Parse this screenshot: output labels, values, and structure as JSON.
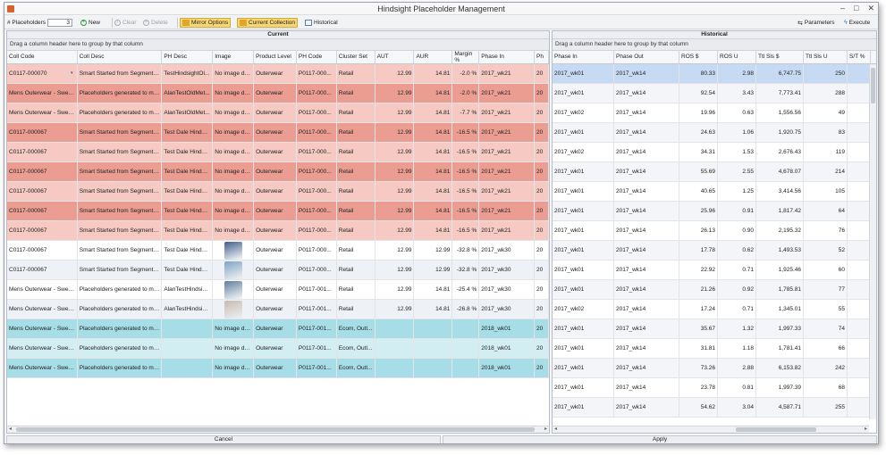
{
  "window": {
    "title": "Hindsight Placeholder Management"
  },
  "toolbar": {
    "placeholders_label": "# Placeholders",
    "placeholders_value": "3",
    "new_label": "New",
    "clear_label": "Clear",
    "delete_label": "Delete",
    "mirror_options_label": "Mirror Options",
    "current_collection_label": "Current Collection",
    "historical_label": "Historical",
    "parameters_label": "Parameters",
    "execute_label": "Execute"
  },
  "current": {
    "title": "Current",
    "group_hint": "Drag a column header here to group by that column",
    "columns": [
      "Coll Code",
      "Coll Desc",
      "PH Desc",
      "Image",
      "Product Level",
      "PH Code",
      "Cluster Set",
      "AUT",
      "AUR",
      "Margin %",
      "Phase In",
      "Ph"
    ],
    "rows": [
      {
        "c": [
          "C0117-000070",
          "Smart Started from Segment ...",
          "TestHindsightOl...",
          "No image data",
          "Outerwear",
          "P0117-000...",
          "Retail",
          "12.99",
          "14.81",
          "-2.0 %",
          "2017_wk21",
          "20"
        ],
        "shade": "light",
        "img": ""
      },
      {
        "c": [
          "Mens Outerwear - Swea...",
          "Placeholders generated to ma...",
          "AlanTestOldMet...",
          "No image data",
          "Outerwear",
          "P0117-000...",
          "Retail",
          "12.99",
          "14.81",
          "-2.0 %",
          "2017_wk21",
          "20"
        ],
        "shade": "dark",
        "img": ""
      },
      {
        "c": [
          "Mens Outerwear - Swea...",
          "Placeholders generated to ma...",
          "AlanTestOldMet...",
          "No image data",
          "Outerwear",
          "P0117-000...",
          "Retail",
          "12.99",
          "14.81",
          "-7.7 %",
          "2017_wk21",
          "20"
        ],
        "shade": "light",
        "img": ""
      },
      {
        "c": [
          "C0117-000067",
          "Smart Started from Segment ...",
          "Test Dale Hindsight",
          "No image data",
          "Outerwear",
          "P0117-000...",
          "Retail",
          "12.99",
          "14.81",
          "-16.5 %",
          "2017_wk21",
          "20"
        ],
        "shade": "dark",
        "img": ""
      },
      {
        "c": [
          "C0117-000067",
          "Smart Started from Segment ...",
          "Test Dale Hindsight",
          "No image data",
          "Outerwear",
          "P0117-000...",
          "Retail",
          "12.99",
          "14.81",
          "-16.5 %",
          "2017_wk21",
          "20"
        ],
        "shade": "light",
        "img": ""
      },
      {
        "c": [
          "C0117-000067",
          "Smart Started from Segment ...",
          "Test Dale Hindsight",
          "No image data",
          "Outerwear",
          "P0117-000...",
          "Retail",
          "12.99",
          "14.81",
          "-16.5 %",
          "2017_wk21",
          "20"
        ],
        "shade": "dark",
        "img": ""
      },
      {
        "c": [
          "C0117-000067",
          "Smart Started from Segment ...",
          "Test Dale Hindsight",
          "No image data",
          "Outerwear",
          "P0117-000...",
          "Retail",
          "12.99",
          "14.81",
          "-16.5 %",
          "2017_wk21",
          "20"
        ],
        "shade": "light",
        "img": ""
      },
      {
        "c": [
          "C0117-000067",
          "Smart Started from Segment ...",
          "Test Dale Hindsight",
          "No image data",
          "Outerwear",
          "P0117-000...",
          "Retail",
          "12.99",
          "14.81",
          "-16.5 %",
          "2017_wk21",
          "20"
        ],
        "shade": "dark",
        "img": ""
      },
      {
        "c": [
          "C0117-000067",
          "Smart Started from Segment ...",
          "Test Dale Hindsight",
          "No image data",
          "Outerwear",
          "P0117-000...",
          "Retail",
          "12.99",
          "14.81",
          "-16.5 %",
          "2017_wk21",
          "20"
        ],
        "shade": "light",
        "img": ""
      },
      {
        "c": [
          "C0117-000067",
          "Smart Started from Segment ...",
          "Test Dale Hindsight",
          "",
          "Outerwear",
          "P0117-000...",
          "Retail",
          "12.99",
          "12.99",
          "-32.8 %",
          "2017_wk30",
          "20"
        ],
        "shade": "white",
        "img": "#3e5d8a"
      },
      {
        "c": [
          "C0117-000067",
          "Smart Started from Segment ...",
          "Test Dale Hindsight",
          "",
          "Outerwear",
          "P0117-000...",
          "Retail",
          "12.99",
          "12.99",
          "-32.8 %",
          "2017_wk30",
          "20"
        ],
        "shade": "white",
        "img": "#7fa3c4"
      },
      {
        "c": [
          "Mens Outerwear - Swea...",
          "Placeholders generated to ma...",
          "AlanTestHindsig...",
          "",
          "Outerwear",
          "P0117-001...",
          "Retail",
          "12.99",
          "14.81",
          "-25.4 %",
          "2017_wk30",
          "20"
        ],
        "shade": "white",
        "img": "#5d7f9e"
      },
      {
        "c": [
          "Mens Outerwear - Swea...",
          "Placeholders generated to ma...",
          "AlanTestHindsig...",
          "",
          "Outerwear",
          "P0117-001...",
          "Retail",
          "12.99",
          "14.81",
          "-26.8 %",
          "2017_wk30",
          "20"
        ],
        "shade": "white",
        "img": "#c9b9ae"
      },
      {
        "c": [
          "Mens Outerwear - Swea...",
          "Placeholders generated to ma...",
          "",
          "No image data",
          "Outerwear",
          "P0117-001...",
          "Ecom, Outl...",
          "",
          "",
          "",
          "2018_wk01",
          "20"
        ],
        "shade": "cyan",
        "img": ""
      },
      {
        "c": [
          "Mens Outerwear - Swea...",
          "Placeholders generated to ma...",
          "",
          "No image data",
          "Outerwear",
          "P0117-001...",
          "Ecom, Outl...",
          "",
          "",
          "",
          "2018_wk01",
          "20"
        ],
        "shade": "cyanl",
        "img": ""
      },
      {
        "c": [
          "Mens Outerwear - Swea...",
          "Placeholders generated to ma...",
          "",
          "No image data",
          "Outerwear",
          "P0117-001...",
          "Ecom, Outl...",
          "",
          "",
          "",
          "2018_wk01",
          "20"
        ],
        "shade": "cyan",
        "img": ""
      }
    ]
  },
  "historical": {
    "title": "Historical",
    "group_hint": "Drag a column header here to group by that column",
    "columns": [
      "Phase In",
      "Phase Out",
      "ROS $",
      "ROS U",
      "Ttl Sls $",
      "Ttl Sls U",
      "S/T %"
    ],
    "rows": [
      [
        "2017_wk01",
        "2017_wk14",
        "80.33",
        "2.98",
        "6,747.75",
        "250",
        ""
      ],
      [
        "2017_wk01",
        "2017_wk14",
        "92.54",
        "3.43",
        "7,773.41",
        "288",
        ""
      ],
      [
        "2017_wk02",
        "2017_wk14",
        "19.96",
        "0.63",
        "1,556.56",
        "49",
        ""
      ],
      [
        "2017_wk01",
        "2017_wk14",
        "24.63",
        "1.06",
        "1,920.75",
        "83",
        ""
      ],
      [
        "2017_wk02",
        "2017_wk14",
        "34.31",
        "1.53",
        "2,676.43",
        "119",
        ""
      ],
      [
        "2017_wk01",
        "2017_wk14",
        "55.69",
        "2.55",
        "4,678.07",
        "214",
        ""
      ],
      [
        "2017_wk01",
        "2017_wk14",
        "40.65",
        "1.25",
        "3,414.56",
        "105",
        ""
      ],
      [
        "2017_wk01",
        "2017_wk14",
        "25.96",
        "0.91",
        "1,817.42",
        "64",
        ""
      ],
      [
        "2017_wk01",
        "2017_wk14",
        "26.13",
        "0.90",
        "2,195.32",
        "76",
        ""
      ],
      [
        "2017_wk01",
        "2017_wk14",
        "17.78",
        "0.62",
        "1,493.53",
        "52",
        ""
      ],
      [
        "2017_wk01",
        "2017_wk14",
        "22.92",
        "0.71",
        "1,925.46",
        "60",
        ""
      ],
      [
        "2017_wk01",
        "2017_wk14",
        "21.26",
        "0.92",
        "1,785.81",
        "77",
        ""
      ],
      [
        "2017_wk02",
        "2017_wk14",
        "17.24",
        "0.71",
        "1,345.01",
        "55",
        ""
      ],
      [
        "2017_wk01",
        "2017_wk14",
        "35.67",
        "1.32",
        "1,997.33",
        "74",
        ""
      ],
      [
        "2017_wk01",
        "2017_wk14",
        "31.81",
        "1.18",
        "1,781.41",
        "66",
        ""
      ],
      [
        "2017_wk01",
        "2017_wk14",
        "73.26",
        "2.88",
        "6,153.82",
        "242",
        ""
      ],
      [
        "2017_wk01",
        "2017_wk14",
        "23.78",
        "0.81",
        "1,997.39",
        "68",
        ""
      ],
      [
        "2017_wk01",
        "2017_wk14",
        "54.62",
        "3.04",
        "4,587.71",
        "255",
        ""
      ]
    ]
  },
  "buttons": {
    "cancel": "Cancel",
    "apply": "Apply"
  },
  "colors": {
    "row_light": "#f6c9c3",
    "row_dark": "#ec9d92",
    "row_white_a": "#ffffff",
    "row_white_b": "#eef2f7",
    "row_cyan": "#a6dde6",
    "row_cyan_light": "#d3eef3",
    "hist_selected": "#c7daf3",
    "hist_alt": "#f3f5f8"
  }
}
